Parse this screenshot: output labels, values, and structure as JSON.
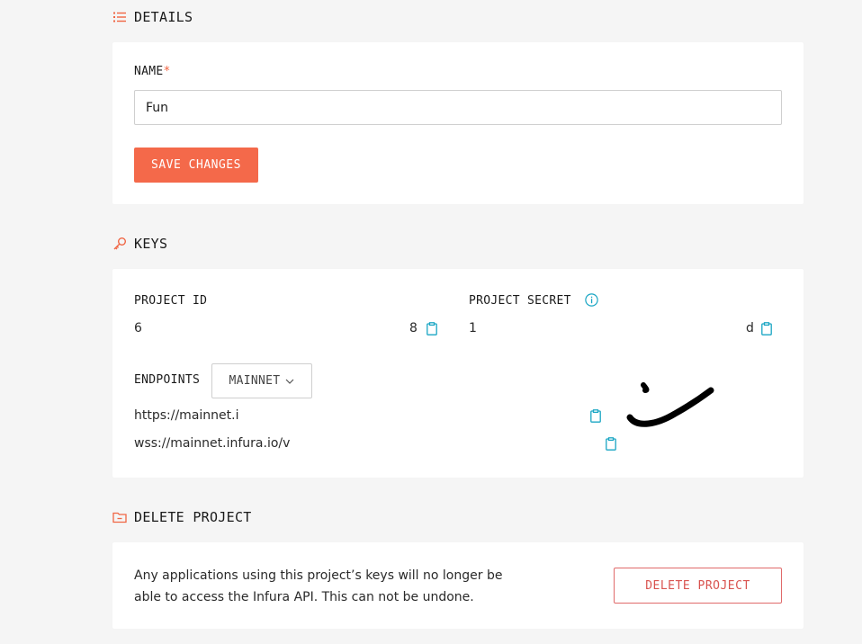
{
  "details": {
    "heading": "DETAILS",
    "name_label": "NAME",
    "required_mark": "*",
    "name_value": "Fun",
    "save_label": "SAVE CHANGES"
  },
  "keys": {
    "heading": "KEYS",
    "project_id_label": "PROJECT ID",
    "project_id_start": "6",
    "project_id_end": "8",
    "project_secret_label": "PROJECT SECRET",
    "project_secret_start": "1",
    "project_secret_end": "d",
    "endpoints_label": "ENDPOINTS",
    "network_selected": "MAINNET",
    "https_endpoint": "https://mainnet.i",
    "wss_endpoint": "wss://mainnet.infura.io/v"
  },
  "delete": {
    "heading": "DELETE PROJECT",
    "warning": "Any applications using this project’s keys will no longer be able to access the Infura API. This can not be undone.",
    "button_label": "DELETE PROJECT"
  },
  "colors": {
    "accent": "#f4694a",
    "danger": "#d9534f",
    "copy_icon": "#1aa6c4"
  },
  "icons": {
    "details": "list-icon",
    "keys": "key-icon",
    "delete": "folder-icon",
    "copy": "clipboard-icon",
    "info": "info-icon",
    "dropdown": "chevron-down-icon"
  }
}
